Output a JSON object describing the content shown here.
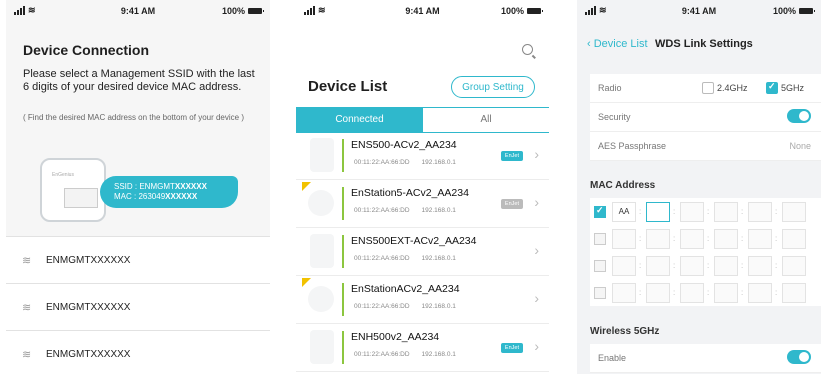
{
  "status": {
    "time": "9:41 AM",
    "battery": "100%"
  },
  "panel1": {
    "title": "Device Connection",
    "description": "Please select a Management SSID with the last 6 digits of your desired device MAC address.",
    "hint": "( Find the desired MAC address on the bottom of your device )",
    "device_brand": "EnGenius",
    "ssid_label": "SSID : ENMGMT",
    "ssid_mask": "XXXXXX",
    "mac_label": "MAC : 263049",
    "mac_mask": "XXXXXX",
    "networks": [
      "ENMGMTXXXXXX",
      "ENMGMTXXXXXX",
      "ENMGMTXXXXXX"
    ]
  },
  "panel2": {
    "title": "Device List",
    "group_setting": "Group Setting",
    "tabs": [
      "Connected",
      "All"
    ],
    "devices": [
      {
        "name": "ENS500-ACv2_AA234",
        "mac": "00:11:22:AA:66:DD",
        "ip": "192.168.0.1",
        "badge": "EnJet",
        "badge_color": "blue"
      },
      {
        "name": "EnStation5-ACv2_AA234",
        "mac": "00:11:22:AA:66:DD",
        "ip": "192.168.0.1",
        "badge": "EnJet",
        "badge_color": "gray"
      },
      {
        "name": "ENS500EXT-ACv2_AA234",
        "mac": "00:11:22:AA:66:DD",
        "ip": "192.168.0.1",
        "badge": "",
        "badge_color": ""
      },
      {
        "name": "EnStationACv2_AA234",
        "mac": "00:11:22:AA:66:DD",
        "ip": "192.168.0.1",
        "badge": "",
        "badge_color": ""
      },
      {
        "name": "ENH500v2_AA234",
        "mac": "00:11:22:AA:66:DD",
        "ip": "192.168.0.1",
        "badge": "EnJet",
        "badge_color": "blue"
      }
    ]
  },
  "panel3": {
    "back": "Device List",
    "title": "WDS Link Settings",
    "radio_label": "Radio",
    "radio_options": [
      "2.4GHz",
      "5GHz"
    ],
    "security_label": "Security",
    "aes_label": "AES Passphrase",
    "aes_value": "None",
    "mac_section": "MAC Address",
    "mac_first_octet": "AA",
    "wireless_section": "Wireless 5GHz",
    "enable_label": "Enable"
  },
  "colors": {
    "accent": "#2fb8cc",
    "highlight": "#8cc63f",
    "flag": "#f2c200"
  }
}
